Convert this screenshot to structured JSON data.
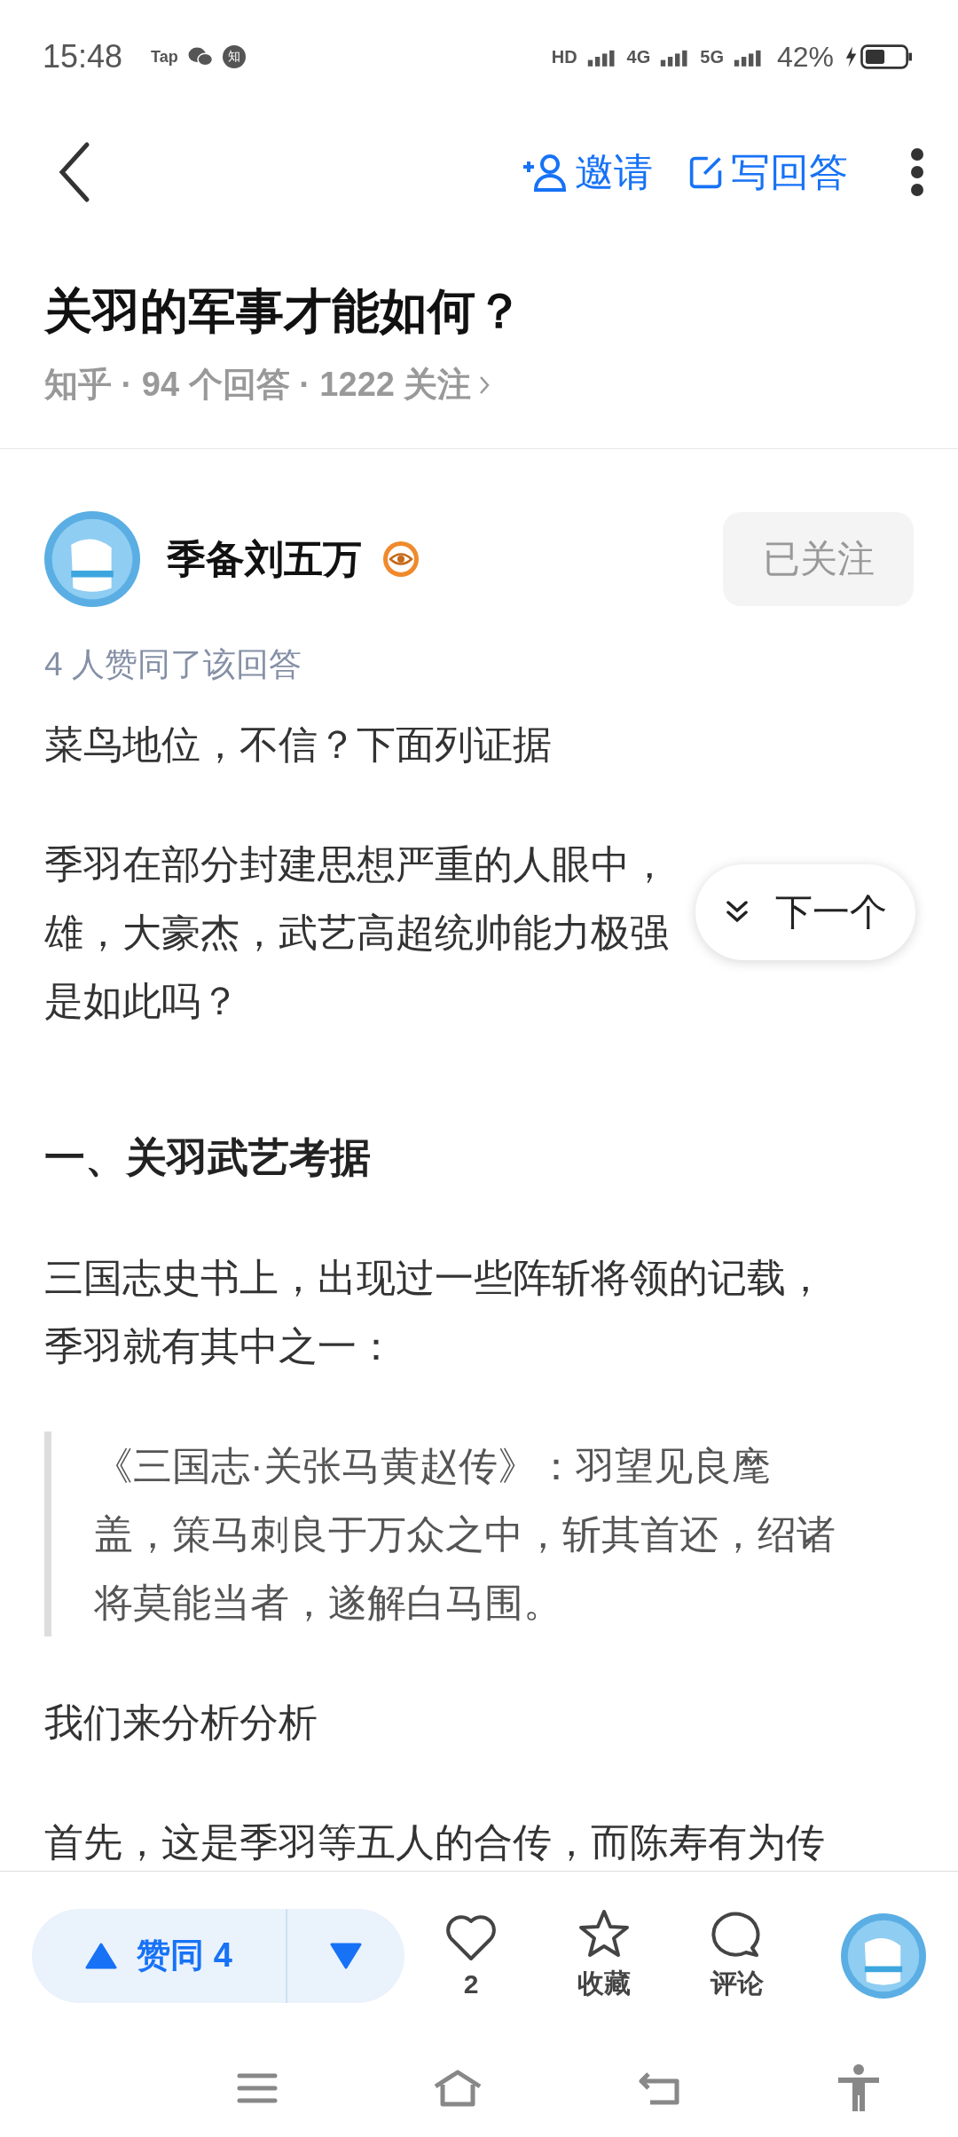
{
  "status_bar": {
    "time": "15:48",
    "app_badges": [
      "Tap",
      "知"
    ],
    "network": [
      "HD",
      "4G",
      "5G"
    ],
    "battery_text": "42%"
  },
  "header": {
    "invite": "邀请",
    "write_answer": "写回答"
  },
  "question": {
    "title": "关羽的军事才能如何？",
    "meta": "知乎 · 94 个回答 · 1222 关注"
  },
  "author": {
    "name": "季备刘五万",
    "follow_button": "已关注",
    "followed": true,
    "upvote_note": "4 人赞同了该回答"
  },
  "content": [
    {
      "kind": "paragraph",
      "lines": [
        "菜鸟地位，不信？下面列证据"
      ]
    },
    {
      "kind": "paragraph",
      "lines": [
        "季羽在部分封建思想严重的人眼中，",
        "雄，大豪杰，武艺高超统帅能力极强",
        "是如此吗？"
      ]
    },
    {
      "kind": "heading",
      "lines": [
        "一、关羽武艺考据"
      ]
    },
    {
      "kind": "paragraph",
      "lines": [
        "三国志史书上，出现过一些阵斩将领的记载，",
        "季羽就有其中之一："
      ]
    },
    {
      "kind": "quote",
      "lines": [
        "《三国志·关张马黄赵传》：羽望见良麾",
        "盖，策马刺良于万众之中，斩其首还，绍诸",
        "将莫能当者，遂解白马围。"
      ]
    },
    {
      "kind": "paragraph",
      "lines": [
        "我们来分析分析"
      ]
    },
    {
      "kind": "paragraph",
      "lines": [
        "首先，这是季羽等五人的合传，而陈寿有为传"
      ]
    }
  ],
  "next_button": "下一个",
  "bottom_bar": {
    "vote_label": "赞同 4",
    "upvoted": false,
    "like_count": "2",
    "collect": "收藏",
    "comment": "评论"
  }
}
